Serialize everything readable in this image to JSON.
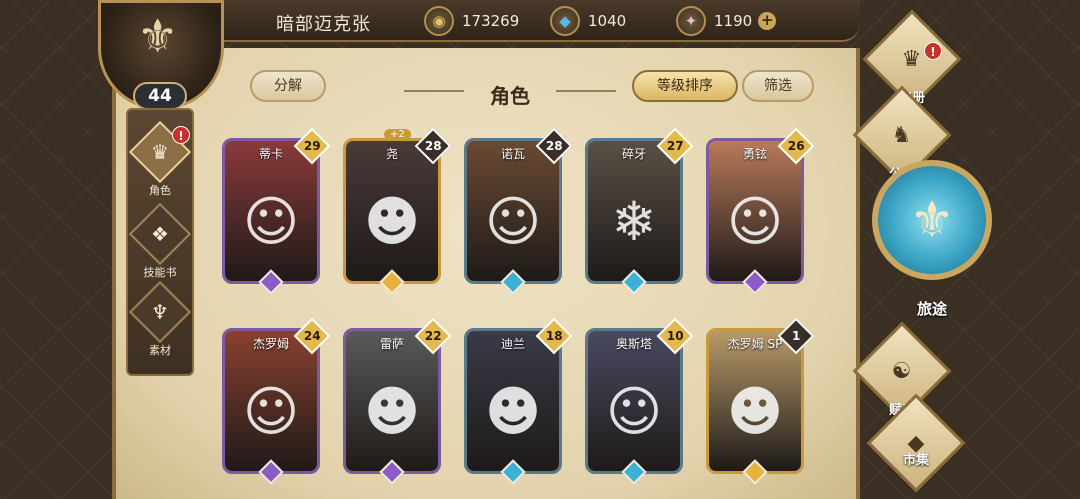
{
  "top_bar": {
    "player_name": "暗部迈克张",
    "currencies": [
      {
        "icon": "gold-coin-icon",
        "value": "173269"
      },
      {
        "icon": "blue-crystal-icon",
        "value": "1040"
      },
      {
        "icon": "pink-gem-icon",
        "value": "1190",
        "plus": "+"
      }
    ]
  },
  "player": {
    "level": "44"
  },
  "left_nav": [
    {
      "label": "角色",
      "icon": "character-helmet-icon",
      "active": true,
      "alert": "!"
    },
    {
      "label": "技能书",
      "icon": "skill-book-icon",
      "active": false
    },
    {
      "label": "素材",
      "icon": "material-icon",
      "active": false
    }
  ],
  "header": {
    "decompose_label": "分解",
    "title": "角色",
    "sort_label": "等级排序",
    "filter_label": "筛选"
  },
  "characters": [
    {
      "name": "蒂卡",
      "level": "29",
      "rarity": "purple",
      "bg": "#8a3a3a",
      "plus": ""
    },
    {
      "name": "尧",
      "level": "28",
      "rarity": "gold",
      "bg": "#4a3a38",
      "plus": "+2"
    },
    {
      "name": "诺瓦",
      "level": "28",
      "rarity": "blue",
      "bg": "#6a4a32",
      "plus": ""
    },
    {
      "name": "碎牙",
      "level": "27",
      "rarity": "blue",
      "bg": "#5a5046",
      "plus": ""
    },
    {
      "name": "勇铉",
      "level": "26",
      "rarity": "purple",
      "bg": "#b87a5a",
      "plus": ""
    },
    {
      "name": "杰罗姆",
      "level": "24",
      "rarity": "purple",
      "bg": "#8a4030",
      "plus": ""
    },
    {
      "name": "雷萨",
      "level": "22",
      "rarity": "purple",
      "bg": "#5a5a58",
      "plus": ""
    },
    {
      "name": "迪兰",
      "level": "18",
      "rarity": "blue",
      "bg": "#3a3a48",
      "plus": ""
    },
    {
      "name": "奥斯塔",
      "level": "10",
      "rarity": "blue",
      "bg": "#4a4a60",
      "plus": ""
    },
    {
      "name": "杰罗姆 SP",
      "level": "1",
      "rarity": "gold",
      "bg": "#b89a6a",
      "plus": ""
    }
  ],
  "right_nav": {
    "soul_book": "魂册",
    "soul_book_alert": "!",
    "guild": "公会",
    "journey": "旅途",
    "talent": "赋魂",
    "market": "市集"
  }
}
